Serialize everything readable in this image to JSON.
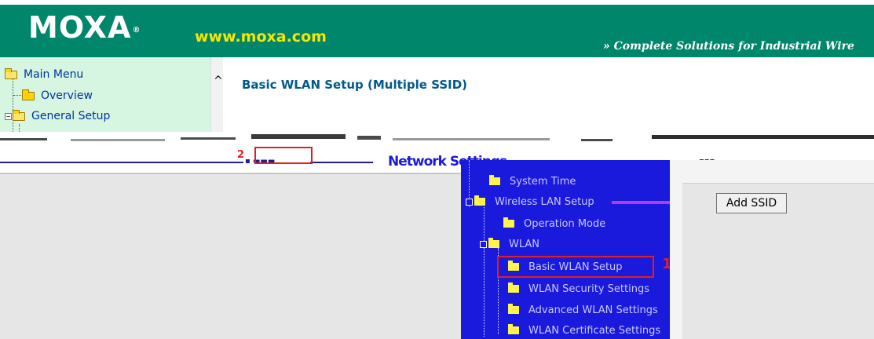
{
  "header": {
    "logo": "MOXA",
    "logo_mark": "®",
    "url": "www.moxa.com",
    "tagline": "» Complete Solutions for Industrial Wire"
  },
  "sidebar": {
    "items": [
      {
        "label": "Main Menu",
        "icon": "folder-open-icon"
      },
      {
        "label": "Overview",
        "icon": "folder-icon"
      },
      {
        "label": "General Setup",
        "icon": "folder-open-icon"
      }
    ]
  },
  "main": {
    "title": "Basic WLAN Setup (Multiple SSID)",
    "network_settings": "Network Settings",
    "add_ssid_label": "Add SSID"
  },
  "overlay_tree": {
    "items": [
      {
        "label": "System Time"
      },
      {
        "label": "Wireless LAN Setup"
      },
      {
        "label": "Operation Mode"
      },
      {
        "label": "WLAN"
      },
      {
        "label": "Basic WLAN Setup"
      },
      {
        "label": "WLAN Security Settings"
      },
      {
        "label": "Advanced WLAN Settings"
      },
      {
        "label": "WLAN Certificate Settings"
      }
    ]
  },
  "annotations": {
    "marker_1": "1",
    "marker_2": "2"
  },
  "colors": {
    "brand_green": "#00866a",
    "url_yellow": "#f5e700",
    "sidebar_bg": "#d6f6e1",
    "title_blue": "#005a8e",
    "overlay_blue": "#1a1adc",
    "highlight_red": "#e02020"
  }
}
